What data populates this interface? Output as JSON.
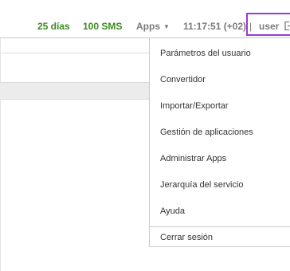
{
  "header": {
    "days": "25 días",
    "sms": "100 SMS",
    "apps_label": "Apps",
    "apps_caret": "▼",
    "clock": "11:17:51 (+02)",
    "separator": "|",
    "user": "user",
    "accent_highlight": "#9b38d6",
    "status_color": "#3b8c1d"
  },
  "user_menu": {
    "items": [
      {
        "label": "Parámetros del usuario"
      },
      {
        "label": "Convertidor"
      },
      {
        "label": "Importar/Exportar"
      },
      {
        "label": "Gestión de aplicaciones"
      },
      {
        "label": "Administrar Apps"
      },
      {
        "label": "Jerarquía del servicio"
      },
      {
        "label": "Ayuda"
      }
    ],
    "logout": "Cerrar sesión"
  },
  "icons": {
    "logout": "logout-icon",
    "apps_dropdown": "caret-down-icon"
  }
}
